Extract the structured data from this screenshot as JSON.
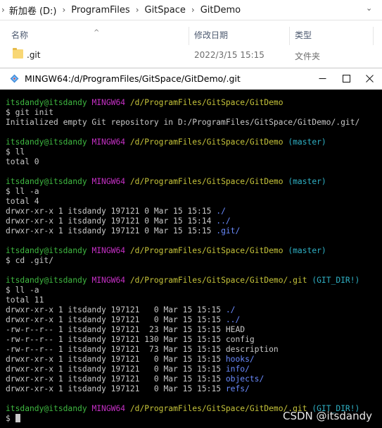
{
  "explorer": {
    "breadcrumb": [
      "新加卷 (D:)",
      "ProgramFiles",
      "GitSpace",
      "GitDemo"
    ],
    "columns": {
      "name": "名称",
      "modified": "修改日期",
      "type": "类型"
    },
    "rows": [
      {
        "name": ".git",
        "modified": "2022/3/15 15:15",
        "type": "文件夹"
      }
    ]
  },
  "terminal": {
    "title": "MINGW64:/d/ProgramFiles/GitSpace/GitDemo/.git",
    "lines": [
      [
        {
          "t": "itsdandy@itsdandy",
          "c": "user"
        },
        {
          "t": " "
        },
        {
          "t": "MINGW64",
          "c": "host"
        },
        {
          "t": " "
        },
        {
          "t": "/d/ProgramFiles/GitSpace/GitDemo",
          "c": "path"
        }
      ],
      [
        {
          "t": "$ git init"
        }
      ],
      [
        {
          "t": "Initialized empty Git repository in D:/ProgramFiles/GitSpace/GitDemo/.git/"
        }
      ],
      [],
      [
        {
          "t": "itsdandy@itsdandy",
          "c": "user"
        },
        {
          "t": " "
        },
        {
          "t": "MINGW64",
          "c": "host"
        },
        {
          "t": " "
        },
        {
          "t": "/d/ProgramFiles/GitSpace/GitDemo",
          "c": "path"
        },
        {
          "t": " "
        },
        {
          "t": "(master)",
          "c": "branch"
        }
      ],
      [
        {
          "t": "$ ll"
        }
      ],
      [
        {
          "t": "total 0"
        }
      ],
      [],
      [
        {
          "t": "itsdandy@itsdandy",
          "c": "user"
        },
        {
          "t": " "
        },
        {
          "t": "MINGW64",
          "c": "host"
        },
        {
          "t": " "
        },
        {
          "t": "/d/ProgramFiles/GitSpace/GitDemo",
          "c": "path"
        },
        {
          "t": " "
        },
        {
          "t": "(master)",
          "c": "branch"
        }
      ],
      [
        {
          "t": "$ ll -a"
        }
      ],
      [
        {
          "t": "total 4"
        }
      ],
      [
        {
          "t": "drwxr-xr-x 1 itsdandy 197121 0 Mar 15 15:15 "
        },
        {
          "t": "./",
          "c": "dir"
        }
      ],
      [
        {
          "t": "drwxr-xr-x 1 itsdandy 197121 0 Mar 15 15:14 "
        },
        {
          "t": "../",
          "c": "dir"
        }
      ],
      [
        {
          "t": "drwxr-xr-x 1 itsdandy 197121 0 Mar 15 15:15 "
        },
        {
          "t": ".git/",
          "c": "dir"
        }
      ],
      [],
      [
        {
          "t": "itsdandy@itsdandy",
          "c": "user"
        },
        {
          "t": " "
        },
        {
          "t": "MINGW64",
          "c": "host"
        },
        {
          "t": " "
        },
        {
          "t": "/d/ProgramFiles/GitSpace/GitDemo",
          "c": "path"
        },
        {
          "t": " "
        },
        {
          "t": "(master)",
          "c": "branch"
        }
      ],
      [
        {
          "t": "$ cd .git/"
        }
      ],
      [],
      [
        {
          "t": "itsdandy@itsdandy",
          "c": "user"
        },
        {
          "t": " "
        },
        {
          "t": "MINGW64",
          "c": "host"
        },
        {
          "t": " "
        },
        {
          "t": "/d/ProgramFiles/GitSpace/GitDemo/.git",
          "c": "path"
        },
        {
          "t": " "
        },
        {
          "t": "(GIT_DIR!)",
          "c": "branch"
        }
      ],
      [
        {
          "t": "$ ll -a"
        }
      ],
      [
        {
          "t": "total 11"
        }
      ],
      [
        {
          "t": "drwxr-xr-x 1 itsdandy 197121   0 Mar 15 15:15 "
        },
        {
          "t": "./",
          "c": "dir"
        }
      ],
      [
        {
          "t": "drwxr-xr-x 1 itsdandy 197121   0 Mar 15 15:15 "
        },
        {
          "t": "../",
          "c": "dir"
        }
      ],
      [
        {
          "t": "-rw-r--r-- 1 itsdandy 197121  23 Mar 15 15:15 HEAD"
        }
      ],
      [
        {
          "t": "-rw-r--r-- 1 itsdandy 197121 130 Mar 15 15:15 config"
        }
      ],
      [
        {
          "t": "-rw-r--r-- 1 itsdandy 197121  73 Mar 15 15:15 description"
        }
      ],
      [
        {
          "t": "drwxr-xr-x 1 itsdandy 197121   0 Mar 15 15:15 "
        },
        {
          "t": "hooks/",
          "c": "dir"
        }
      ],
      [
        {
          "t": "drwxr-xr-x 1 itsdandy 197121   0 Mar 15 15:15 "
        },
        {
          "t": "info/",
          "c": "dir"
        }
      ],
      [
        {
          "t": "drwxr-xr-x 1 itsdandy 197121   0 Mar 15 15:15 "
        },
        {
          "t": "objects/",
          "c": "dir"
        }
      ],
      [
        {
          "t": "drwxr-xr-x 1 itsdandy 197121   0 Mar 15 15:15 "
        },
        {
          "t": "refs/",
          "c": "dir"
        }
      ],
      [],
      [
        {
          "t": "itsdandy@itsdandy",
          "c": "user"
        },
        {
          "t": " "
        },
        {
          "t": "MINGW64",
          "c": "host"
        },
        {
          "t": " "
        },
        {
          "t": "/d/ProgramFiles/GitSpace/GitDemo/.git",
          "c": "path"
        },
        {
          "t": " "
        },
        {
          "t": "(GIT_DIR!)",
          "c": "branch"
        }
      ],
      [
        {
          "t": "$ "
        }
      ]
    ],
    "watermark": "CSDN @itsdandy"
  },
  "colors": {
    "user": "#3fb941",
    "host": "#c530c5",
    "path": "#c6c43a",
    "branch": "#2fb1c5",
    "dir": "#6b8cff",
    "background": "#000000",
    "text": "#c8c8c8"
  },
  "icons": {
    "window_buttons": [
      "minimize-icon",
      "maximize-icon",
      "close-icon"
    ],
    "folder": "folder-icon",
    "terminal_logo": "mingw-logo-icon"
  }
}
